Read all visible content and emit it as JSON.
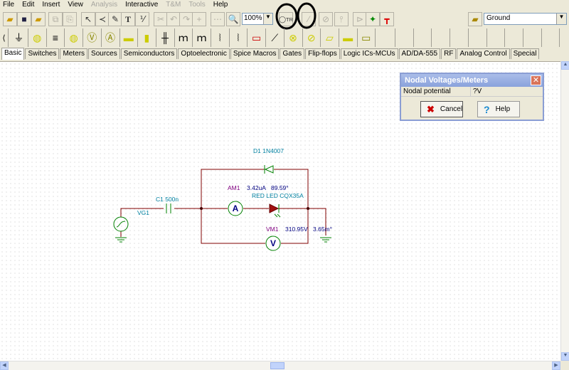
{
  "menu": [
    {
      "label": "File",
      "enabled": true
    },
    {
      "label": "Edit",
      "enabled": true
    },
    {
      "label": "Insert",
      "enabled": true
    },
    {
      "label": "View",
      "enabled": true
    },
    {
      "label": "Analysis",
      "enabled": false
    },
    {
      "label": "Interactive",
      "enabled": true
    },
    {
      "label": "T&M",
      "enabled": false
    },
    {
      "label": "Tools",
      "enabled": false
    },
    {
      "label": "Help",
      "enabled": true
    }
  ],
  "toolbar": {
    "zoom_value": "100%",
    "component_select": "Ground",
    "text_tool": "T"
  },
  "component_tabs": [
    "Basic",
    "Switches",
    "Meters",
    "Sources",
    "Semiconductors",
    "Optoelectronic",
    "Spice Macros",
    "Gates",
    "Flip-flops",
    "Logic ICs-MCUs",
    "AD/DA-555",
    "RF",
    "Analog Control",
    "Special"
  ],
  "active_tab": "Basic",
  "dialog": {
    "title": "Nodal Voltages/Meters",
    "row_label": "Nodal potential",
    "row_value": "?V",
    "cancel_label": "Cancel",
    "help_label": "Help"
  },
  "circuit": {
    "vg1": "VG1",
    "c1": "C1 500n",
    "d1": "D1 1N4007",
    "am1": "AM1",
    "am1_value": "3.42uA",
    "am1_phase": "89.59°",
    "led": "RED LED CQX35A",
    "vm1": "VM1",
    "vm1_value": "310.95V",
    "vm1_phase": "3.65m°",
    "ammeter_symbol": "A",
    "voltmeter_symbol": "V"
  },
  "colors": {
    "wire": "#800000",
    "component": "#008000",
    "label_blue": "#0080a0",
    "label_purple": "#800080",
    "meter_value": "#000080"
  }
}
